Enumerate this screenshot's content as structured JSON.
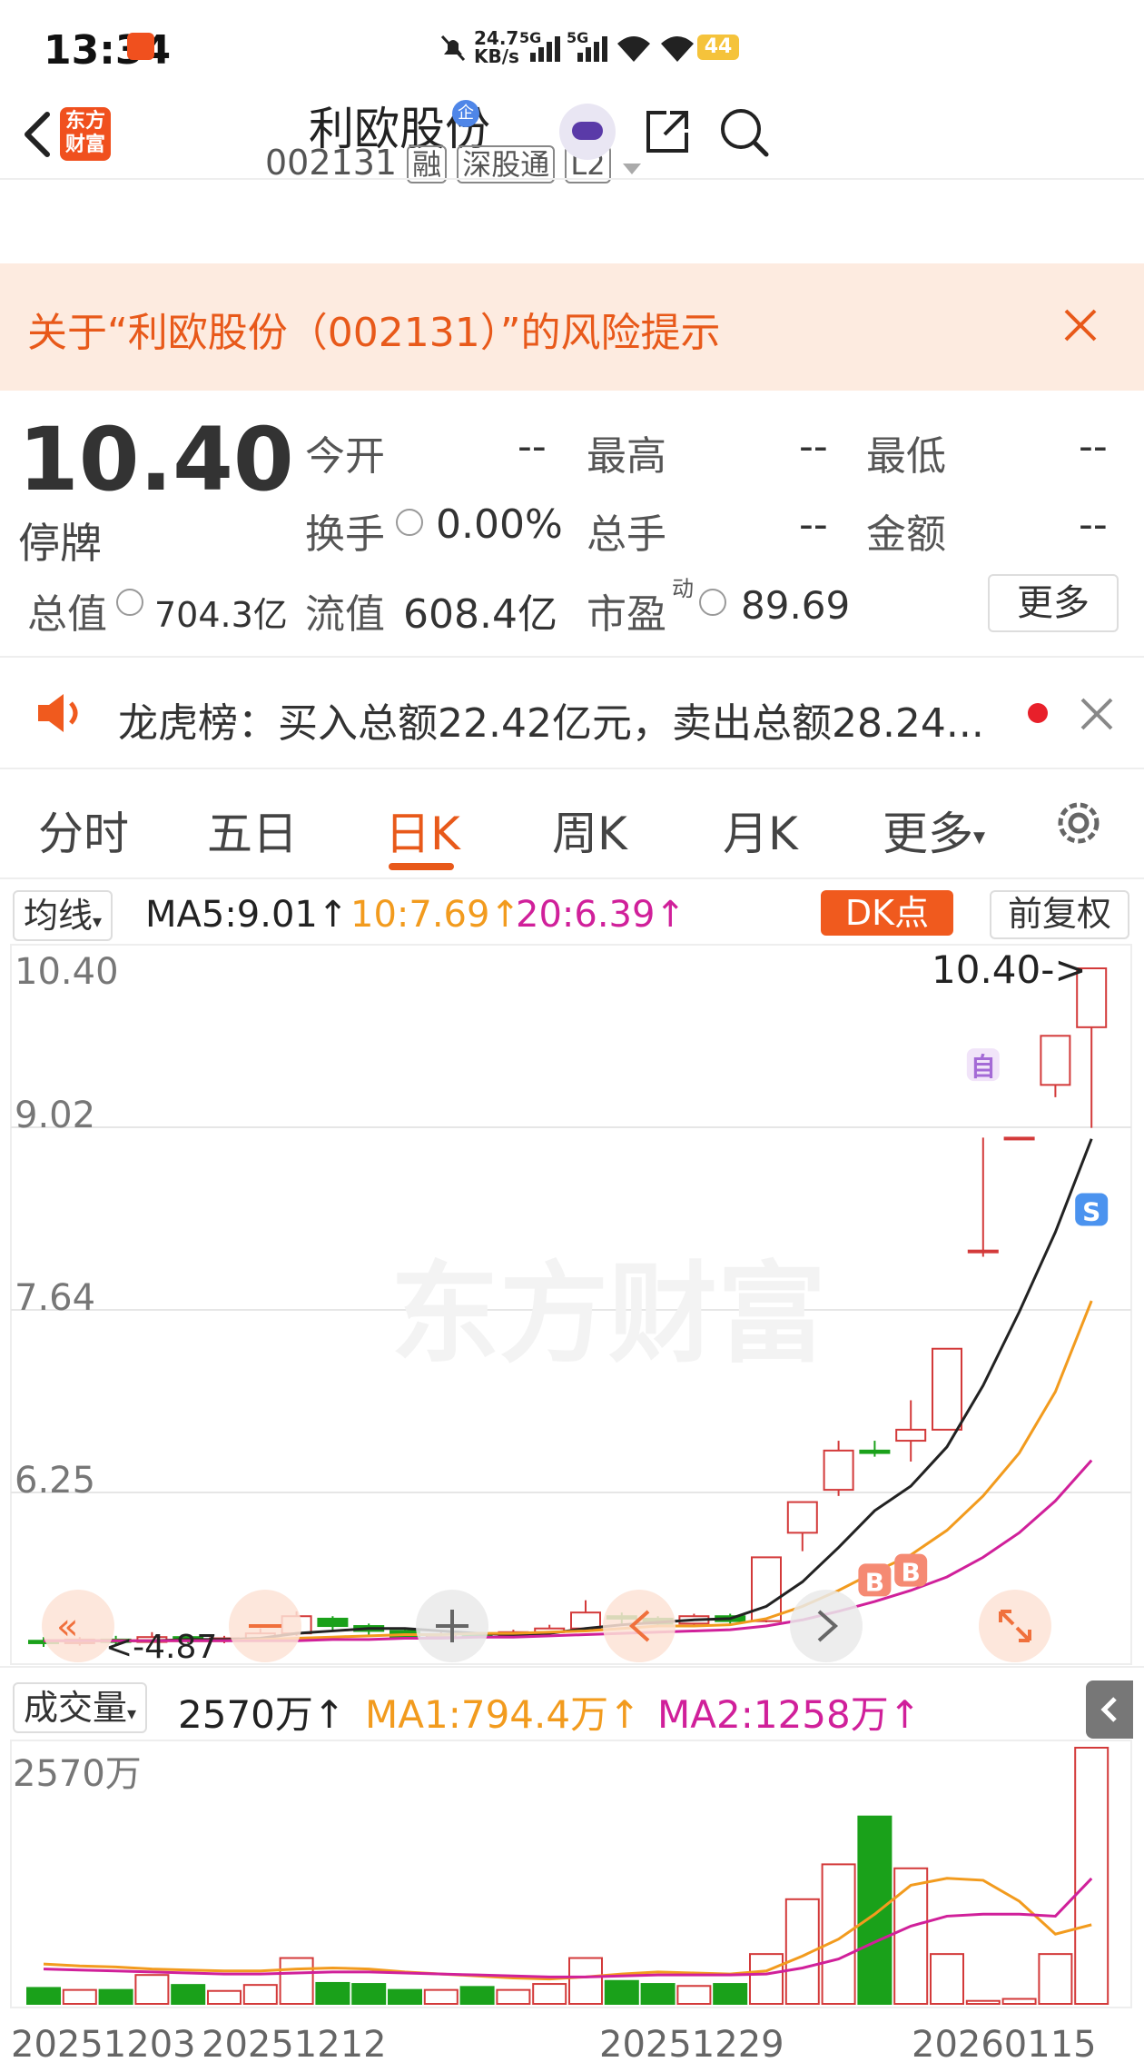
{
  "status": {
    "time": "13:34",
    "net_speed": "24.7",
    "net_unit": "KB/s",
    "sig1": "5G",
    "sig2": "5G",
    "battery": "44"
  },
  "header": {
    "title": "利欧股份",
    "code": "002131",
    "tags": [
      "融",
      "深股通",
      "L2"
    ],
    "logo_text_1": "东方",
    "logo_text_2": "财富",
    "badge": "企"
  },
  "risk": {
    "text": "关于“利欧股份（002131）”的风险提示"
  },
  "quote": {
    "price": "10.40",
    "status": "停牌",
    "open_label": "今开",
    "open_val": "--",
    "high_label": "最高",
    "high_val": "--",
    "low_label": "最低",
    "low_val": "--",
    "turnover_label": "换手",
    "turnover_val": "0.00%",
    "volume_label": "总手",
    "volume_val": "--",
    "amount_label": "金额",
    "amount_val": "--",
    "mktcap_label": "总值",
    "mktcap_val": "704.3亿",
    "float_label": "流值",
    "float_val": "608.4亿",
    "pe_label": "市盈",
    "pe_sup": "动",
    "pe_val": "89.69",
    "more_label": "更多"
  },
  "notice": {
    "text": "龙虎榜：买入总额22.42亿元，卖出总额28.24..."
  },
  "tabs": [
    "分时",
    "五日",
    "日K",
    "周K",
    "月K",
    "更多"
  ],
  "active_tab": 2,
  "ma_bar": {
    "select": "均线",
    "ma5": "MA5:9.01",
    "ma10": "10:7.69",
    "ma20": "20:6.39",
    "dk": "DK点",
    "adjust": "前复权"
  },
  "colors": {
    "up": "#d33a3a",
    "down": "#1aa11a",
    "ma5": "#222222",
    "ma10": "#f29b1e",
    "ma20": "#d0209a",
    "accent": "#e8591a"
  },
  "vol_bar": {
    "select": "成交量",
    "vol": "2570万",
    "ma1": "MA1:794.4万",
    "ma2": "MA2:1258万"
  },
  "chart_data": {
    "type": "candlestick",
    "price_axis_labels": [
      "10.40",
      "9.02",
      "7.64",
      "6.25"
    ],
    "price_range": [
      4.87,
      10.4
    ],
    "last_price_label": "10.40->",
    "low_label": "<-4.87",
    "markers": [
      "自",
      "B",
      "B",
      "S"
    ],
    "volume_axis_label": "2570万",
    "date_labels": [
      "20251203",
      "20251212",
      "20251229",
      "20260115"
    ],
    "candles": [
      {
        "o": 4.92,
        "c": 4.9,
        "h": 4.95,
        "l": 4.87
      },
      {
        "o": 4.9,
        "c": 4.93,
        "h": 4.95,
        "l": 4.88
      },
      {
        "o": 4.93,
        "c": 4.91,
        "h": 4.96,
        "l": 4.89
      },
      {
        "o": 4.91,
        "c": 4.95,
        "h": 4.99,
        "l": 4.9
      },
      {
        "o": 4.95,
        "c": 4.92,
        "h": 4.97,
        "l": 4.9
      },
      {
        "o": 4.92,
        "c": 4.94,
        "h": 4.96,
        "l": 4.9
      },
      {
        "o": 4.94,
        "c": 4.98,
        "h": 5.02,
        "l": 4.93
      },
      {
        "o": 4.98,
        "c": 5.12,
        "h": 5.16,
        "l": 4.96
      },
      {
        "o": 5.1,
        "c": 5.04,
        "h": 5.12,
        "l": 5.0
      },
      {
        "o": 5.04,
        "c": 5.0,
        "h": 5.06,
        "l": 4.97
      },
      {
        "o": 5.0,
        "c": 4.95,
        "h": 5.02,
        "l": 4.93
      },
      {
        "o": 4.95,
        "c": 4.97,
        "h": 4.99,
        "l": 4.93
      },
      {
        "o": 4.97,
        "c": 4.96,
        "h": 4.99,
        "l": 4.94
      },
      {
        "o": 4.96,
        "c": 4.99,
        "h": 5.01,
        "l": 4.95
      },
      {
        "o": 4.99,
        "c": 5.02,
        "h": 5.05,
        "l": 4.97
      },
      {
        "o": 5.02,
        "c": 5.15,
        "h": 5.25,
        "l": 5.01
      },
      {
        "o": 5.12,
        "c": 5.1,
        "h": 5.15,
        "l": 5.06
      },
      {
        "o": 5.1,
        "c": 5.06,
        "h": 5.12,
        "l": 5.03
      },
      {
        "o": 5.06,
        "c": 5.12,
        "h": 5.14,
        "l": 5.04
      },
      {
        "o": 5.12,
        "c": 5.08,
        "h": 5.14,
        "l": 5.05
      },
      {
        "o": 5.08,
        "c": 5.6,
        "h": 5.6,
        "l": 5.07
      },
      {
        "o": 5.8,
        "c": 6.05,
        "h": 6.05,
        "l": 5.65
      },
      {
        "o": 6.15,
        "c": 6.47,
        "h": 6.55,
        "l": 6.1
      },
      {
        "o": 6.47,
        "c": 6.45,
        "h": 6.55,
        "l": 6.42
      },
      {
        "o": 6.55,
        "c": 6.64,
        "h": 6.88,
        "l": 6.38
      },
      {
        "o": 6.64,
        "c": 7.3,
        "h": 7.3,
        "l": 6.64
      },
      {
        "o": 8.1,
        "c": 8.1,
        "h": 9.02,
        "l": 8.05
      },
      {
        "o": 9.02,
        "c": 9.02,
        "h": 9.02,
        "l": 9.02
      },
      {
        "o": 9.45,
        "c": 9.85,
        "h": 9.85,
        "l": 9.35
      },
      {
        "o": 9.92,
        "c": 10.4,
        "h": 10.4,
        "l": 9.1
      }
    ],
    "ma5": [
      4.92,
      4.92,
      4.92,
      4.92,
      4.93,
      4.93,
      4.94,
      4.98,
      5.0,
      5.02,
      5.02,
      5.0,
      4.98,
      4.97,
      4.98,
      5.02,
      5.05,
      5.07,
      5.09,
      5.1,
      5.2,
      5.4,
      5.68,
      5.98,
      6.18,
      6.5,
      7.0,
      7.6,
      8.25,
      9.01
    ],
    "ma10": [
      4.92,
      4.92,
      4.92,
      4.92,
      4.92,
      4.92,
      4.93,
      4.94,
      4.95,
      4.96,
      4.97,
      4.97,
      4.98,
      4.98,
      4.99,
      5.0,
      5.02,
      5.04,
      5.04,
      5.05,
      5.1,
      5.2,
      5.33,
      5.48,
      5.62,
      5.82,
      6.1,
      6.45,
      6.95,
      7.69
    ],
    "ma20": [
      4.92,
      4.92,
      4.92,
      4.92,
      4.92,
      4.92,
      4.92,
      4.92,
      4.93,
      4.93,
      4.94,
      4.94,
      4.95,
      4.95,
      4.96,
      4.97,
      4.98,
      4.99,
      5.0,
      5.01,
      5.04,
      5.09,
      5.16,
      5.24,
      5.33,
      5.44,
      5.6,
      5.8,
      6.06,
      6.39
    ],
    "volume_wan": [
      160,
      140,
      140,
      290,
      190,
      130,
      190,
      460,
      210,
      200,
      140,
      140,
      170,
      140,
      200,
      460,
      230,
      200,
      180,
      200,
      500,
      1050,
      1400,
      1880,
      1360,
      500,
      30,
      50,
      500,
      2570
    ],
    "vol_ma1": [
      400,
      380,
      370,
      350,
      340,
      330,
      330,
      350,
      360,
      350,
      320,
      300,
      280,
      260,
      250,
      270,
      300,
      320,
      310,
      300,
      330,
      480,
      650,
      900,
      1190,
      1260,
      1240,
      1030,
      700,
      794
    ],
    "vol_ma2": [
      350,
      340,
      330,
      320,
      310,
      300,
      300,
      310,
      320,
      320,
      310,
      300,
      290,
      280,
      270,
      270,
      280,
      290,
      290,
      290,
      300,
      360,
      450,
      620,
      780,
      880,
      900,
      900,
      880,
      1258
    ]
  }
}
